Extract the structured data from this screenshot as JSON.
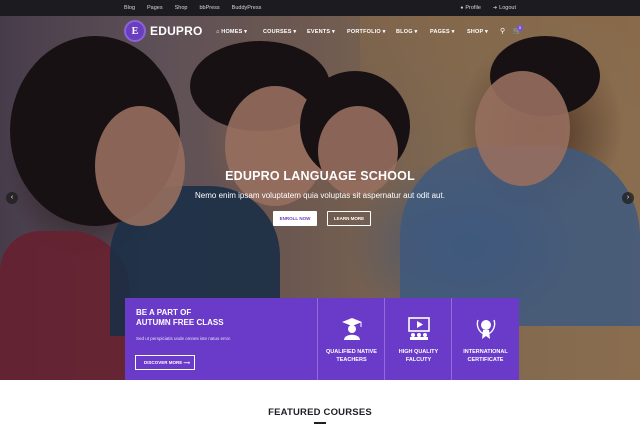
{
  "topbar": {
    "links": [
      "Blog",
      "Pages",
      "Shop",
      "bbPress",
      "BuddyPress"
    ],
    "profile": "Profile",
    "logout": "Logout"
  },
  "brand": {
    "initial": "E",
    "name": "EDUPRO"
  },
  "nav": {
    "items": [
      "HOMES",
      "COURSES",
      "EVENTS",
      "PORTFOLIO",
      "BLOG",
      "PAGES",
      "SHOP"
    ],
    "cart_count": "0"
  },
  "hero": {
    "title": "EDUPRO LANGUAGE SCHOOL",
    "subtitle": "Nemo enim ipsam voluptatem quia voluptas sit aspernatur aut odit aut.",
    "enroll_label": "ENROLL NOW",
    "learn_label": "LEARN MORE",
    "prev": "‹",
    "next": "›"
  },
  "panel": {
    "title_line1": "BE A PART OF",
    "title_line2": "AUTUMN FREE CLASS",
    "text": "Sed ut perspiciatis unde omnes iste natus error.",
    "discover_label": "DISCOVER MORE",
    "features": [
      {
        "line1": "QUALIFIED NATIVE",
        "line2": "TEACHERS",
        "icon": "graduate-icon"
      },
      {
        "line1": "HIGH QUALITY",
        "line2": "FALCUTY",
        "icon": "presentation-icon"
      },
      {
        "line1": "INTERNATIONAL",
        "line2": "CERTIFICATE",
        "icon": "award-icon"
      }
    ]
  },
  "featured": {
    "title": "FEATURED COURSES"
  },
  "colors": {
    "accent": "#6a3bc9",
    "topbar": "#1b1b20"
  }
}
